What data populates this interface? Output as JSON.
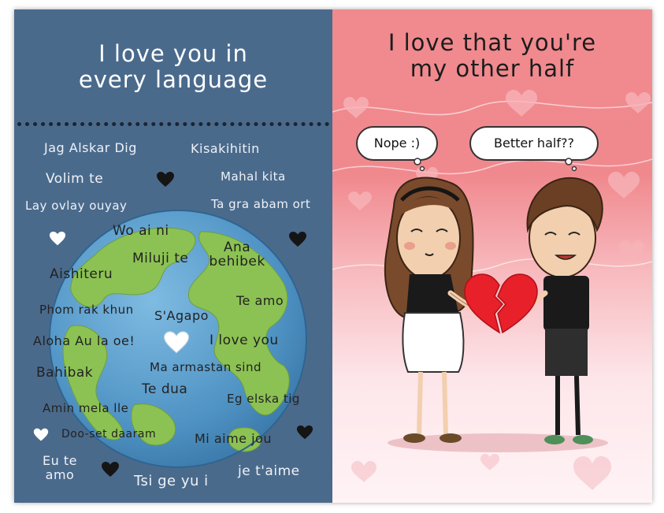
{
  "left_panel": {
    "title_line1": "I love you in",
    "title_line2": "every language",
    "colors": {
      "background": "#4a6a8c",
      "ocean": "#4f93c4",
      "land": "#7fb84a"
    },
    "phrases": {
      "jag_alskar_dig": "Jag Alskar Dig",
      "kisakihitin": "Kisakihitin",
      "volim_te": "Volim te",
      "mahal_kita": "Mahal kita",
      "lay_ovlay_ouyay": "Lay ovlay ouyay",
      "ta_gra_abam_ort": "Ta gra abam ort",
      "wo_ai_ni": "Wo ai ni",
      "miluji_te": "Miluji te",
      "ana_line1": "Ana",
      "ana_line2": "behibek",
      "aishiteru": "Aishiteru",
      "phom_rak_khun": "Phom rak khun",
      "te_amo": "Te amo",
      "sagapo": "S'Agapo",
      "aloha": "Aloha Au la oe!",
      "i_love_you": "I love you",
      "bahibak": "Bahibak",
      "ma_armastan_sind": "Ma armastan sind",
      "te_dua": "Te dua",
      "eg_elska_tig": "Eg elska tig",
      "amin_mela_lle": "Amin mela lle",
      "doo_set_daaram": "Doo-set daaram",
      "mi_aime_jou": "Mi aime jou",
      "eu_te_line1": "Eu te",
      "eu_te_line2": "amo",
      "tsi_ge_yu_i": "Tsi ge yu i",
      "je_taime": "je t'aime"
    }
  },
  "right_panel": {
    "title_line1": "I love that you're",
    "title_line2": "my other half",
    "bubble_left": "Nope :)",
    "bubble_right": "Better half??",
    "colors": {
      "background_top": "#f08a8e",
      "heart": "#e8202a"
    }
  }
}
